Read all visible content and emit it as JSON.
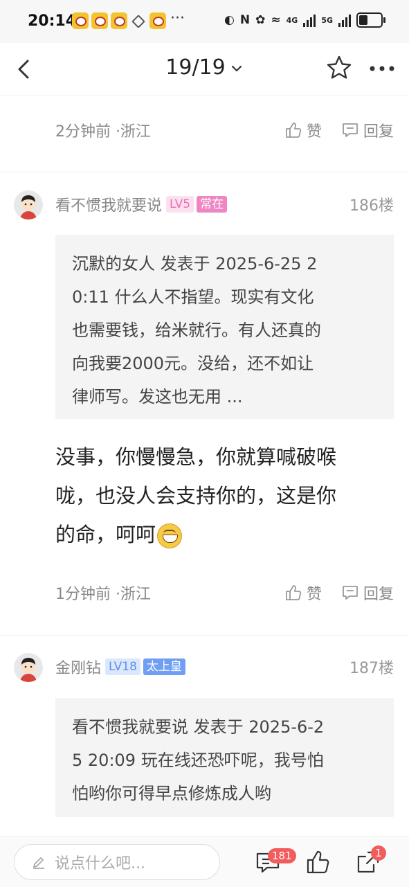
{
  "status_bar": {
    "time": "20:14",
    "more": "···",
    "net1": "4G",
    "net2": "5G"
  },
  "header": {
    "page_indicator": "19/19"
  },
  "prev_post": {
    "meta": "2分钟前 ·浙江",
    "like_label": "赞",
    "reply_label": "回复"
  },
  "posts": [
    {
      "username": "看不惯我就要说",
      "level": "LV5",
      "tag": "常在",
      "floor": "186楼",
      "quote_lines": [
        "沉默的女人 发表于 2025-6-25 2",
        "0:11 什么人不指望。现实有文化",
        "也需要钱，给米就行。有人还真的",
        "向我要2000元。没给，还不如让",
        "律师写。发这也无用 ..."
      ],
      "body_lines": [
        "没事，你慢慢急，你就算喊破喉",
        "咙，也没人会支持你的，这是你",
        "的命，呵呵"
      ],
      "meta": "1分钟前 ·浙江",
      "like_label": "赞",
      "reply_label": "回复"
    },
    {
      "username": "金刚钻",
      "level": "LV18",
      "tag": "太上皇",
      "floor": "187楼",
      "quote_lines": [
        "看不惯我就要说 发表于 2025-6-2",
        "5 20:09 玩在线还恐吓呢，我号怕",
        "怕哟你可得早点修炼成人哟"
      ]
    }
  ],
  "bottom_bar": {
    "input_placeholder": "说点什么吧...",
    "comment_count": "181",
    "share_count": "1"
  },
  "colors": {
    "accent_pink": "#ee86c3",
    "accent_blue": "#6f9ef3",
    "badge_red": "#f25c5c"
  }
}
